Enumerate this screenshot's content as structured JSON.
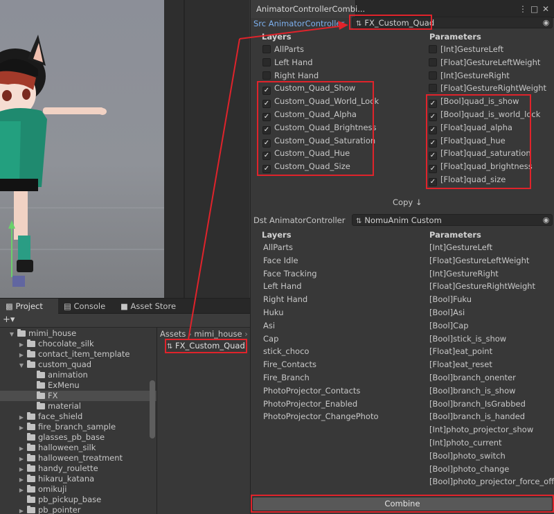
{
  "tool_window": {
    "tab_title": "AnimatorControllerCombi...",
    "src_label": "Src AnimatorController",
    "src_value": "FX_Custom_Quad",
    "dst_label": "Dst AnimatorController",
    "dst_value": "NomuAnim Custom",
    "copy_label": "Copy ↓",
    "combine_label": "Combine",
    "src": {
      "layers_header": "Layers",
      "params_header": "Parameters",
      "layers": [
        {
          "label": "AllParts",
          "checked": false
        },
        {
          "label": "Left Hand",
          "checked": false
        },
        {
          "label": "Right Hand",
          "checked": false
        },
        {
          "label": "Custom_Quad_Show",
          "checked": true
        },
        {
          "label": "Custom_Quad_World_Lock",
          "checked": true
        },
        {
          "label": "Custom_Quad_Alpha",
          "checked": true
        },
        {
          "label": "Custom_Quad_Brightness",
          "checked": true
        },
        {
          "label": "Custom_Quad_Saturation",
          "checked": true
        },
        {
          "label": "Custom_Quad_Hue",
          "checked": true
        },
        {
          "label": "Custom_Quad_Size",
          "checked": true
        }
      ],
      "params": [
        {
          "label": "[Int]GestureLeft",
          "checked": false
        },
        {
          "label": "[Float]GestureLeftWeight",
          "checked": false
        },
        {
          "label": "[Int]GestureRight",
          "checked": false
        },
        {
          "label": "[Float]GestureRightWeight",
          "checked": false
        },
        {
          "label": "[Bool]quad_is_show",
          "checked": true
        },
        {
          "label": "[Bool]quad_is_world_lock",
          "checked": true
        },
        {
          "label": "[Float]quad_alpha",
          "checked": true
        },
        {
          "label": "[Float]quad_hue",
          "checked": true
        },
        {
          "label": "[Float]quad_saturation",
          "checked": true
        },
        {
          "label": "[Float]quad_brightness",
          "checked": true
        },
        {
          "label": "[Float]quad_size",
          "checked": true
        }
      ]
    },
    "dst": {
      "layers_header": "Layers",
      "params_header": "Parameters",
      "layers": [
        "AllParts",
        "Face Idle",
        "Face Tracking",
        "Left Hand",
        "Right Hand",
        "Huku",
        "Asi",
        "Cap",
        "stick_choco",
        "Fire_Contacts",
        "Fire_Branch",
        "PhotoProjector_Contacts",
        "PhotoProjector_Enabled",
        "PhotoProjector_ChangePhoto"
      ],
      "params": [
        "[Int]GestureLeft",
        "[Float]GestureLeftWeight",
        "[Int]GestureRight",
        "[Float]GestureRightWeight",
        "[Bool]Fuku",
        "[Bool]Asi",
        "[Bool]Cap",
        "[Bool]stick_is_show",
        "[Float]eat_point",
        "[Float]eat_reset",
        "[Bool]branch_onenter",
        "[Bool]branch_is_show",
        "[Bool]branch_IsGrabbed",
        "[Bool]branch_is_handed",
        "[Int]photo_projector_show",
        "[Int]photo_current",
        "[Bool]photo_switch",
        "[Bool]photo_change",
        "[Bool]photo_projector_force_off"
      ]
    }
  },
  "project_panel": {
    "tabs": [
      "Project",
      "Console",
      "Asset Store"
    ],
    "add_button": "+▾",
    "breadcrumb": [
      "Assets",
      "mimi_house"
    ],
    "selected_asset": "FX_Custom_Quad",
    "tree": [
      {
        "label": "mimi_house",
        "expanded": true,
        "depth": 0
      },
      {
        "label": "chocolate_silk",
        "expanded": false,
        "depth": 1
      },
      {
        "label": "contact_item_template",
        "expanded": false,
        "depth": 1
      },
      {
        "label": "custom_quad",
        "expanded": true,
        "depth": 1
      },
      {
        "label": "animation",
        "expanded": null,
        "depth": 2
      },
      {
        "label": "ExMenu",
        "expanded": null,
        "depth": 2
      },
      {
        "label": "FX",
        "expanded": null,
        "depth": 2,
        "selected": true
      },
      {
        "label": "material",
        "expanded": null,
        "depth": 2
      },
      {
        "label": "face_shield",
        "expanded": false,
        "depth": 1
      },
      {
        "label": "fire_branch_sample",
        "expanded": false,
        "depth": 1
      },
      {
        "label": "glasses_pb_base",
        "expanded": null,
        "depth": 1
      },
      {
        "label": "halloween_silk",
        "expanded": false,
        "depth": 1
      },
      {
        "label": "halloween_treatment",
        "expanded": false,
        "depth": 1
      },
      {
        "label": "handy_roulette",
        "expanded": false,
        "depth": 1
      },
      {
        "label": "hikaru_katana",
        "expanded": false,
        "depth": 1
      },
      {
        "label": "omikuji",
        "expanded": false,
        "depth": 1
      },
      {
        "label": "pb_pickup_base",
        "expanded": null,
        "depth": 1
      },
      {
        "label": "pb_pointer",
        "expanded": false,
        "depth": 1
      }
    ]
  },
  "colors": {
    "highlight": "#e0232b",
    "accent_link": "#7db1f0"
  }
}
